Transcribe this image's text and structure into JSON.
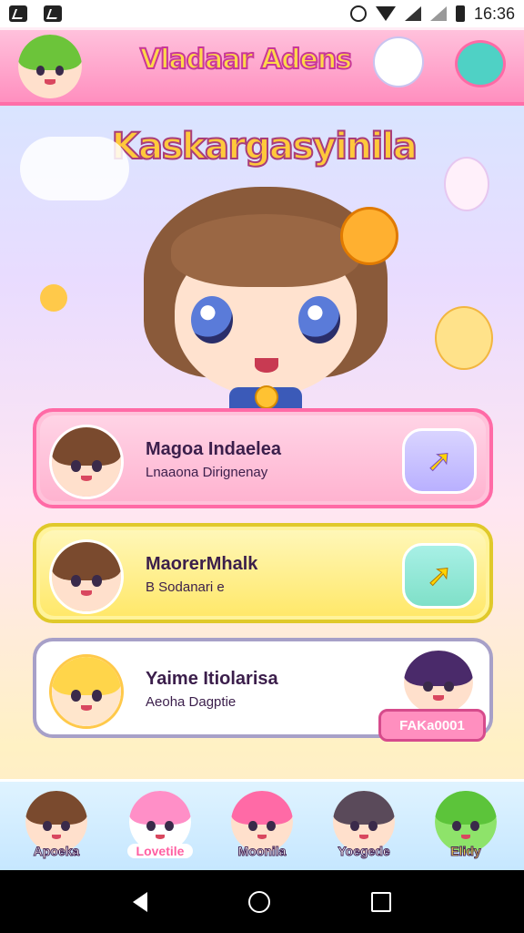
{
  "status_bar": {
    "time": "16:36"
  },
  "header": {
    "title": "Vladaar Adens"
  },
  "hero": {
    "title": "Kaskargasyinila"
  },
  "cards": [
    {
      "name": "Magoa Indaelea",
      "subtitle": "Lnaaona Dirignenay",
      "accent": "#ff6aa6"
    },
    {
      "name": "MaorerMhalk",
      "subtitle": "B Sodanari e",
      "accent": "#e0c92a"
    },
    {
      "name": "Yaime Itiolarisa",
      "subtitle": "Aeoha Dagptie",
      "accent": "#a7a0c8"
    }
  ],
  "badge": {
    "label": "FAKa0001"
  },
  "tabs": [
    {
      "label": "Apoeka"
    },
    {
      "label": "Lovetile"
    },
    {
      "label": "Moonila"
    },
    {
      "label": "Yoegede"
    },
    {
      "label": "Elidy"
    }
  ],
  "icons": [
    "notification-icon",
    "alarm-icon",
    "wifi-icon",
    "signal-icon",
    "battery-icon",
    "arrow-right-icon",
    "back-icon",
    "home-icon",
    "recents-icon"
  ]
}
